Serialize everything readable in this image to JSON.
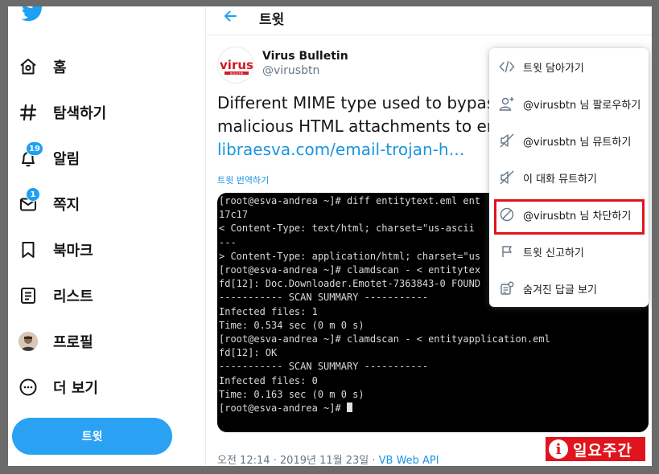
{
  "sidebar": {
    "items": [
      {
        "label": "홈",
        "icon": "home-icon"
      },
      {
        "label": "탐색하기",
        "icon": "hashtag-icon"
      },
      {
        "label": "알림",
        "icon": "bell-icon",
        "badge": "19"
      },
      {
        "label": "쪽지",
        "icon": "envelope-icon",
        "badge": "1"
      },
      {
        "label": "북마크",
        "icon": "bookmark-icon"
      },
      {
        "label": "리스트",
        "icon": "list-icon"
      },
      {
        "label": "프로필",
        "icon": "avatar"
      },
      {
        "label": "더 보기",
        "icon": "more-icon"
      }
    ],
    "tweet_button": "트윗"
  },
  "header": {
    "title": "트윗"
  },
  "tweet": {
    "author_name": "Virus Bulletin",
    "author_handle": "@virusbtn",
    "avatar_text": "virus",
    "avatar_subtext": "BULLETIN",
    "text_line1": "Different MIME type used to bypass",
    "text_line2": "malicious HTML attachments to em",
    "link": "libraesva.com/email-trojan-h…",
    "translate": "트윗 번역하기",
    "timestamp": "오전 12:14 · 2019년 11월 23일 · ",
    "source": "VB Web API"
  },
  "terminal": {
    "lines": [
      "[root@esva-andrea ~]# diff entitytext.eml ent",
      "17c17",
      "< Content-Type: text/html; charset=\"us-ascii",
      "---",
      "> Content-Type: application/html; charset=\"us",
      "[root@esva-andrea ~]# clamdscan - < entitytex",
      "fd[12]: Doc.Downloader.Emotet-7363843-0 FOUND",
      "",
      "----------- SCAN SUMMARY -----------",
      "Infected files: 1",
      "Time: 0.534 sec (0 m 0 s)",
      "[root@esva-andrea ~]# clamdscan - < entityapplication.eml",
      "fd[12]: OK",
      "",
      "----------- SCAN SUMMARY -----------",
      "Infected files: 0",
      "Time: 0.163 sec (0 m 0 s)",
      "[root@esva-andrea ~]# "
    ]
  },
  "menu": {
    "items": [
      {
        "label": "트윗 담아가기",
        "icon": "code-icon"
      },
      {
        "label": "@virusbtn 님 팔로우하기",
        "icon": "follow-icon"
      },
      {
        "label": "@virusbtn 님 뮤트하기",
        "icon": "mute-icon"
      },
      {
        "label": "이 대화 뮤트하기",
        "icon": "mute-conversation-icon"
      },
      {
        "label": "@virusbtn 님 차단하기",
        "icon": "block-icon"
      },
      {
        "label": "트윗 신고하기",
        "icon": "flag-icon"
      },
      {
        "label": "숨겨진 답글 보기",
        "icon": "hidden-replies-icon"
      }
    ]
  },
  "watermark": {
    "icon": "i",
    "text": "일요주간"
  },
  "colors": {
    "accent": "#1da1f2",
    "highlight": "#e0141c"
  }
}
